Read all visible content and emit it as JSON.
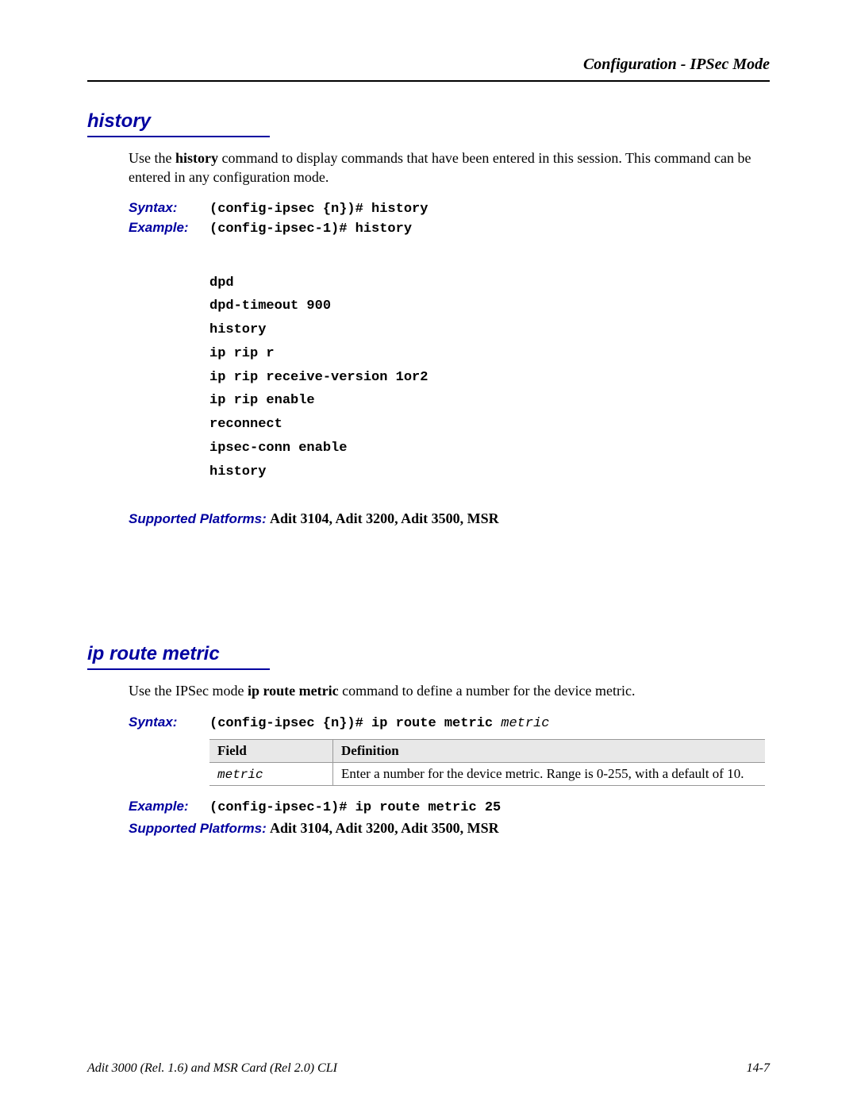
{
  "header": {
    "title": "Configuration - IPSec Mode"
  },
  "sections": {
    "history": {
      "title": "history",
      "intro_pre": "Use the ",
      "intro_cmd": "history",
      "intro_post": " command to display commands that have been entered in this session.  This command can be entered in any configuration mode.",
      "syntax_label": "Syntax:",
      "syntax_value": "(config-ipsec {n})# history",
      "example_label": "Example:",
      "example_value": "(config-ipsec-1)# history",
      "output_lines": [
        "dpd",
        "dpd-timeout 900",
        "history",
        "ip rip r",
        "ip rip receive-version 1or2",
        "ip rip enable",
        "reconnect",
        "ipsec-conn enable",
        "history"
      ],
      "platforms_label": "Supported Platforms:",
      "platforms_value": " Adit 3104, Adit 3200, Adit 3500, MSR"
    },
    "iproute": {
      "title": "ip route metric",
      "intro_pre": "Use the IPSec mode ",
      "intro_cmd": "ip route metric",
      "intro_post": " command to define a number for the device metric.",
      "syntax_label": "Syntax:",
      "syntax_value": "(config-ipsec {n})# ip route metric ",
      "syntax_arg": "metric",
      "table": {
        "col1": "Field",
        "col2": "Definition",
        "field": "metric",
        "definition": "Enter a number for the device metric. Range is 0-255, with a default of 10."
      },
      "example_label": "Example:",
      "example_value": "(config-ipsec-1)# ip route metric 25",
      "platforms_label": "Supported Platforms:",
      "platforms_value": " Adit 3104, Adit 3200, Adit 3500, MSR"
    }
  },
  "footer": {
    "left": "Adit 3000 (Rel. 1.6) and MSR Card (Rel 2.0) CLI",
    "right": "14-7"
  }
}
